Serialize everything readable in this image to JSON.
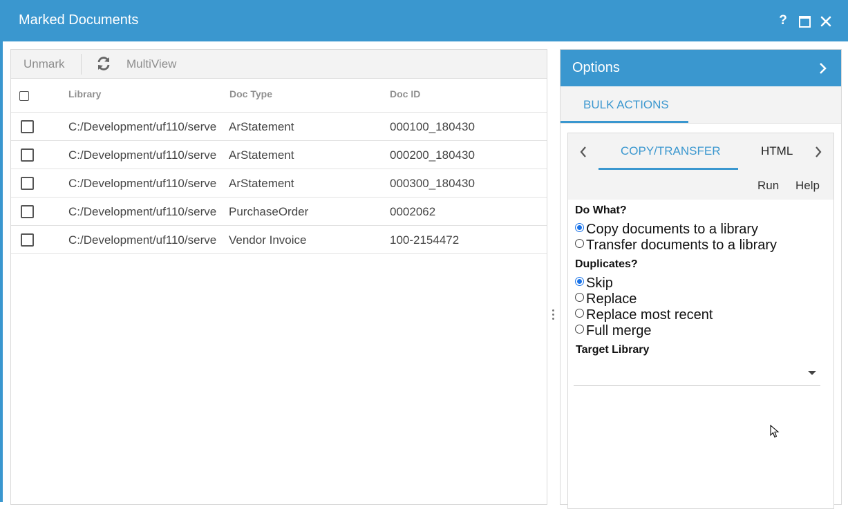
{
  "window": {
    "title": "Marked Documents",
    "help_label": "?",
    "accent_color": "#3a97cf"
  },
  "toolbar": {
    "unmark_label": "Unmark",
    "refresh_icon": "refresh-icon",
    "multiview_label": "MultiView"
  },
  "grid": {
    "columns": [
      "Library",
      "Doc Type",
      "Doc ID"
    ],
    "rows": [
      {
        "library": "C:/Development/uf110/serve",
        "doc_type": "ArStatement",
        "doc_id": "000100_180430"
      },
      {
        "library": "C:/Development/uf110/serve",
        "doc_type": "ArStatement",
        "doc_id": "000200_180430"
      },
      {
        "library": "C:/Development/uf110/serve",
        "doc_type": "ArStatement",
        "doc_id": "000300_180430"
      },
      {
        "library": "C:/Development/uf110/serve",
        "doc_type": "PurchaseOrder",
        "doc_id": "0002062"
      },
      {
        "library": "C:/Development/uf110/serve",
        "doc_type": "Vendor Invoice",
        "doc_id": "100-2154472"
      }
    ]
  },
  "options": {
    "title": "Options",
    "bulk_tab": "BULK ACTIONS",
    "tabs": [
      "COPY/TRANSFER",
      "HTML"
    ],
    "actions": {
      "run": "Run",
      "help": "Help"
    },
    "do_what": {
      "label": "Do What?",
      "choices": [
        "Copy documents to a library",
        "Transfer documents to a library"
      ],
      "selected": "Copy documents to a library"
    },
    "duplicates": {
      "label": "Duplicates?",
      "choices": [
        "Skip",
        "Replace",
        "Replace most recent",
        "Full merge"
      ],
      "selected": "Skip"
    },
    "target_library": {
      "label": "Target Library",
      "value": ""
    }
  }
}
